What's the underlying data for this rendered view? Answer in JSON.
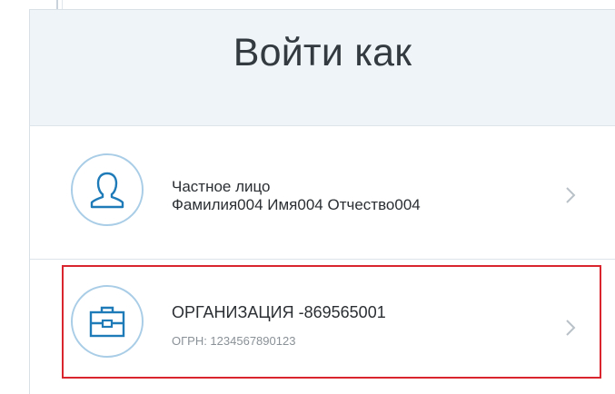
{
  "header": {
    "title": "Войти как"
  },
  "accounts": [
    {
      "type": "Частное лицо",
      "name": "Фамилия004 Имя004 Отчество004",
      "icon": "user-icon"
    },
    {
      "type": "ОРГАНИЗАЦИЯ -869565001",
      "detail": "ОГРН: 1234567890123",
      "icon": "briefcase-icon"
    }
  ],
  "colors": {
    "header_bg": "#eef4f7",
    "icon_stroke": "#1f7bb8",
    "circle_border": "#a9cde6",
    "highlight": "#d9262e",
    "chevron": "#b9c1c8"
  }
}
